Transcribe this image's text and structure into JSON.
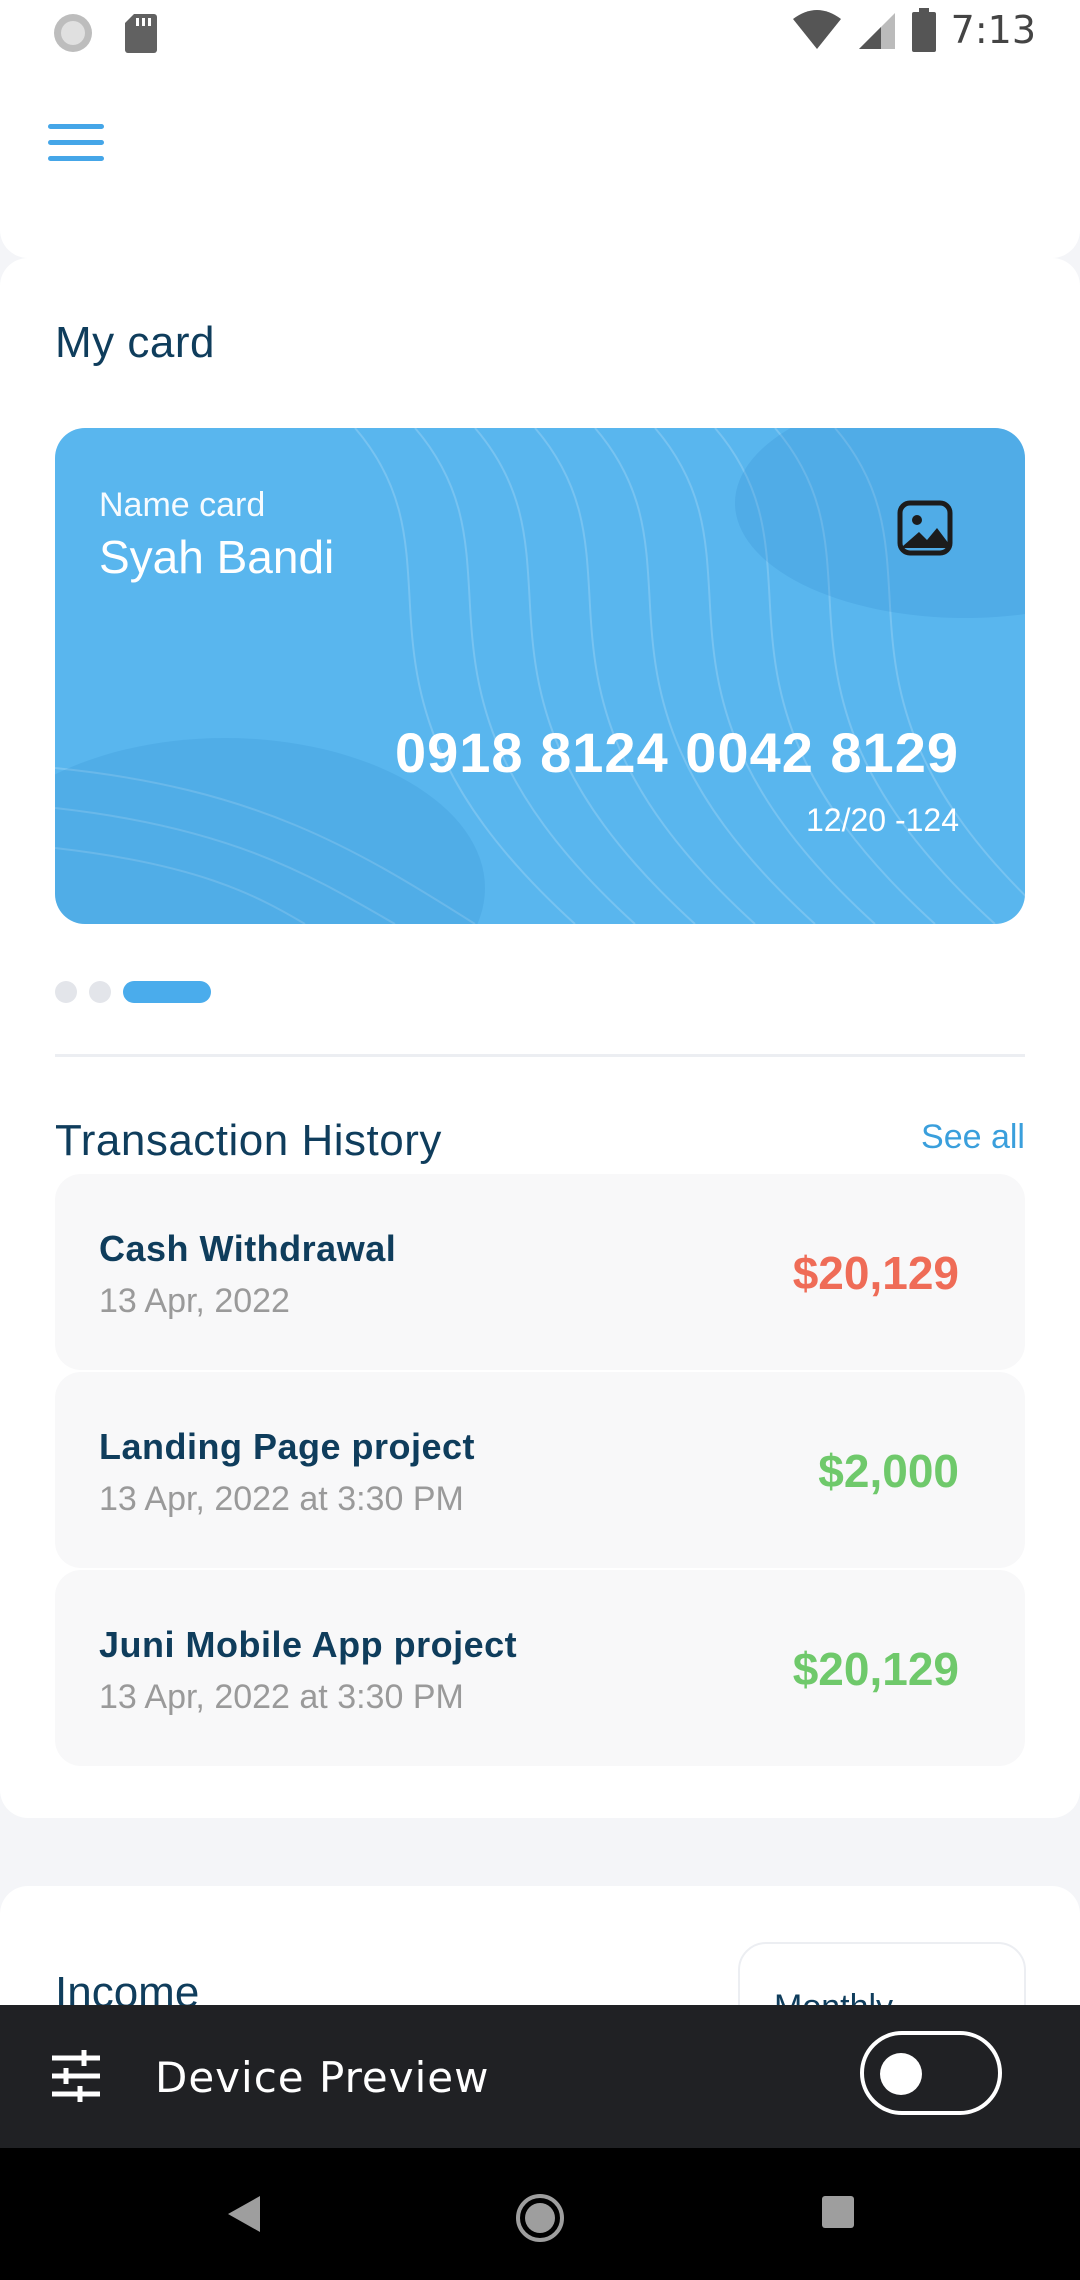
{
  "status_bar": {
    "time": "7:13"
  },
  "my_card": {
    "title": "My card",
    "card": {
      "label": "Name card",
      "holder": "Syah Bandi",
      "number": "0918 8124 0042 8129",
      "expiry": "12/20 -124",
      "icon": "image-icon",
      "color": "#59b6ee"
    },
    "pager": {
      "count": 3,
      "active_index": 2
    }
  },
  "transactions": {
    "title": "Transaction History",
    "see_all": "See all",
    "items": [
      {
        "title": "Cash Withdrawal",
        "date": "13 Apr, 2022",
        "amount": "$20,129",
        "type": "debit"
      },
      {
        "title": "Landing Page project",
        "date": "13 Apr, 2022 at 3:30 PM",
        "amount": "$2,000",
        "type": "credit"
      },
      {
        "title": "Juni Mobile App project",
        "date": "13 Apr, 2022 at 3:30 PM",
        "amount": "$20,129",
        "type": "credit"
      }
    ]
  },
  "income": {
    "title": "Income",
    "period": "Monthly"
  },
  "device_preview": {
    "label": "Device Preview",
    "enabled": false
  },
  "colors": {
    "accent": "#45a6e8",
    "debit": "#ef6c57",
    "credit": "#6fc96b",
    "heading": "#0f3d5c"
  }
}
